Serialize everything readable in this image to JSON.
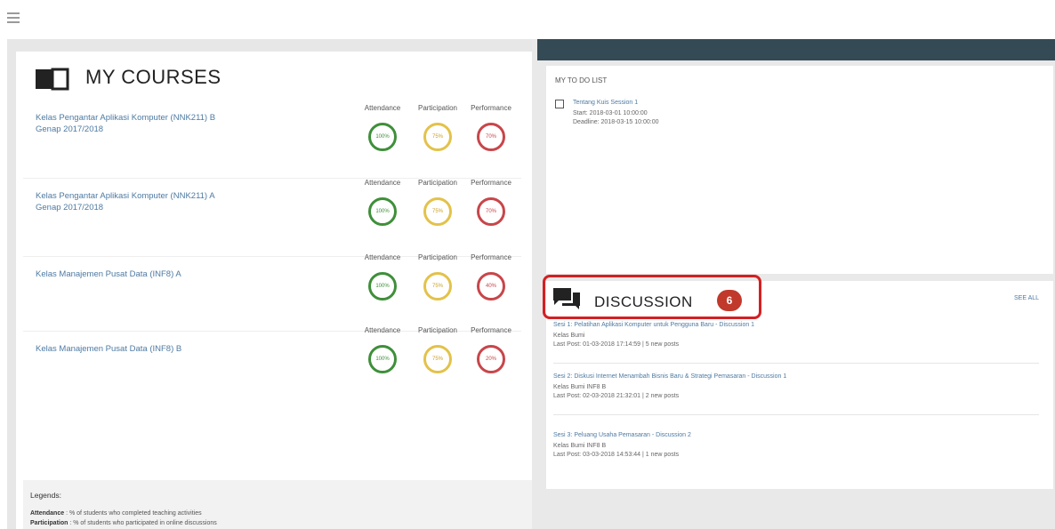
{
  "header": {
    "menu_icon": "hamburger-icon"
  },
  "courses": {
    "title": "MY COURSES",
    "icon": "book-icon",
    "metric_labels": {
      "attendance": "Attendance",
      "participation": "Participation",
      "performance": "Performance"
    },
    "items": [
      {
        "name": "Kelas Pengantar Aplikasi Komputer (NNK211) B Genap 2017/2018",
        "attendance": "100%",
        "participation": "75%",
        "performance": "70%"
      },
      {
        "name": "Kelas Pengantar Aplikasi Komputer (NNK211) A Genap 2017/2018",
        "attendance": "100%",
        "participation": "75%",
        "performance": "70%"
      },
      {
        "name": "Kelas Manajemen Pusat Data (INF8) A",
        "attendance": "100%",
        "participation": "75%",
        "performance": "40%"
      },
      {
        "name": "Kelas Manajemen Pusat Data (INF8) B",
        "attendance": "100%",
        "participation": "75%",
        "performance": "20%"
      }
    ],
    "legend": {
      "title": "Legends:",
      "attendance_term": "Attendance",
      "attendance_desc": ": % of students who completed teaching activities",
      "participation_term": "Participation",
      "participation_desc": ": % of students who participated in online discussions"
    }
  },
  "todo": {
    "title": "MY TO DO LIST",
    "items": [
      {
        "link": "Tentang Kuis Session 1",
        "start": "Start: 2018-03-01 10:00:00",
        "deadline": "Deadline: 2018-03-15 10:00:00"
      }
    ]
  },
  "discussion": {
    "title": "DISCUSSION",
    "icon": "chat-bubbles-icon",
    "badge": "6",
    "see_all": "SEE ALL",
    "items": [
      {
        "link": "Sesi 1: Pelatihan Aplikasi Komputer untuk Pengguna Baru - Discussion 1",
        "class": "Kelas Bumi",
        "post": "Last Post: 01-03-2018 17:14:59 | 5 new posts"
      },
      {
        "link": "Sesi 2: Diskusi Internet Menambah Bisnis Baru & Strategi Pemasaran - Discussion 1",
        "class": "Kelas Bumi INF8 B",
        "post": "Last Post: 02-03-2018 21:32:01 | 2 new posts"
      },
      {
        "link": "Sesi 3: Peluang Usaha Pemasaran - Discussion 2",
        "class": "Kelas Bumi INF8 B",
        "post": "Last Post: 03-03-2018 14:53:44 | 1 new posts"
      }
    ]
  },
  "colors": {
    "green": "#3f8f3a",
    "yellow": "#e3c24a",
    "red": "#c8464a",
    "highlight": "#d32023",
    "badge": "#c0392b",
    "link": "#4e7aa3",
    "dark_bar": "#344a55"
  }
}
